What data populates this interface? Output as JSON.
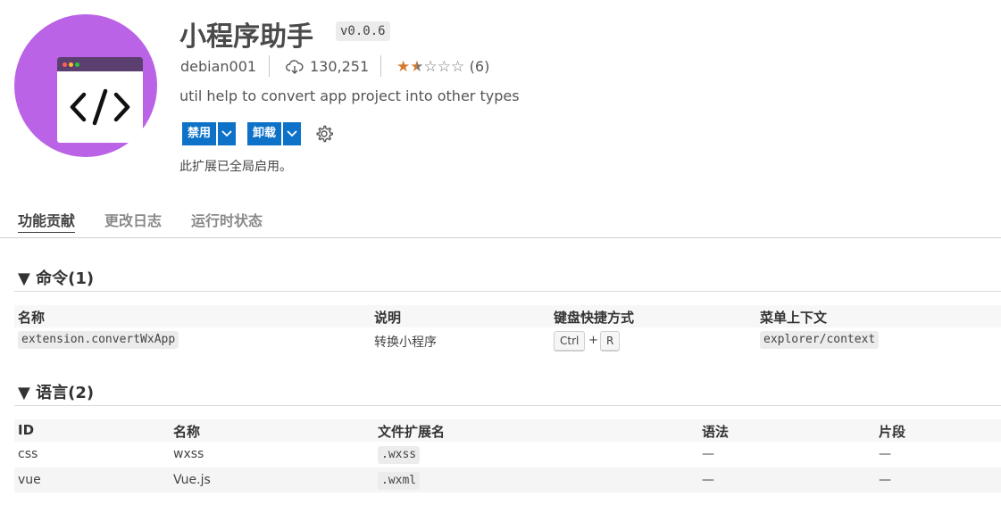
{
  "extension": {
    "title": "小程序助手",
    "version": "v0.0.6",
    "publisher": "debian001",
    "installs": "130,251",
    "rating_count": "(6)",
    "rating": 2.5,
    "description": "util help to convert app project into other types",
    "status_text": "此扩展已全局启用。"
  },
  "buttons": {
    "disable_label": "禁用",
    "uninstall_label": "卸载"
  },
  "tabs": [
    "功能贡献",
    "更改日志",
    "运行时状态"
  ],
  "commands": {
    "title": "命令(1)",
    "headers": [
      "名称",
      "说明",
      "键盘快捷方式",
      "菜单上下文"
    ],
    "rows": [
      {
        "name": "extension.convertWxApp",
        "desc": "转换小程序",
        "keys": [
          "Ctrl",
          "R"
        ],
        "plus": "+",
        "menu": "explorer/context"
      }
    ]
  },
  "languages": {
    "title": "语言(2)",
    "headers": [
      "ID",
      "名称",
      "文件扩展名",
      "语法",
      "片段"
    ],
    "rows": [
      {
        "id": "css",
        "name": "wxss",
        "ext": ".wxss",
        "grammar": "—",
        "snippets": "—"
      },
      {
        "id": "vue",
        "name": "Vue.js",
        "ext": ".wxml",
        "grammar": "—",
        "snippets": "—"
      }
    ]
  },
  "colors": {
    "accent": "#0e72c8",
    "logo": "#bb63e6",
    "star": "#d57a2a"
  }
}
